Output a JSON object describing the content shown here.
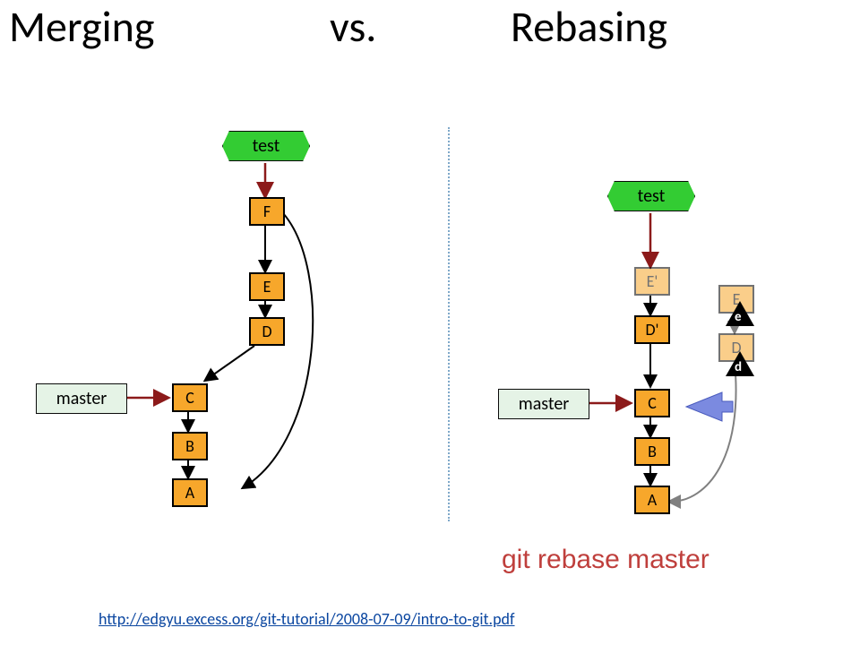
{
  "title": {
    "left": "Merging",
    "mid": "vs.",
    "right": "Rebasing"
  },
  "left": {
    "branch_test": "test",
    "branch_master": "master",
    "commits": {
      "A": "A",
      "B": "B",
      "C": "C",
      "D": "D",
      "E": "E",
      "F": "F"
    }
  },
  "right": {
    "branch_test": "test",
    "branch_master": "master",
    "commits": {
      "A": "A",
      "B": "B",
      "C": "C",
      "Dp": "D'",
      "Ep": "E'",
      "D": "D",
      "E": "E"
    },
    "deltas": {
      "d": "d",
      "e": "e"
    }
  },
  "caption": "git rebase master",
  "source_url": "http://edgyu.excess.org/git-tutorial/2008-07-09/intro-to-git.pdf"
}
